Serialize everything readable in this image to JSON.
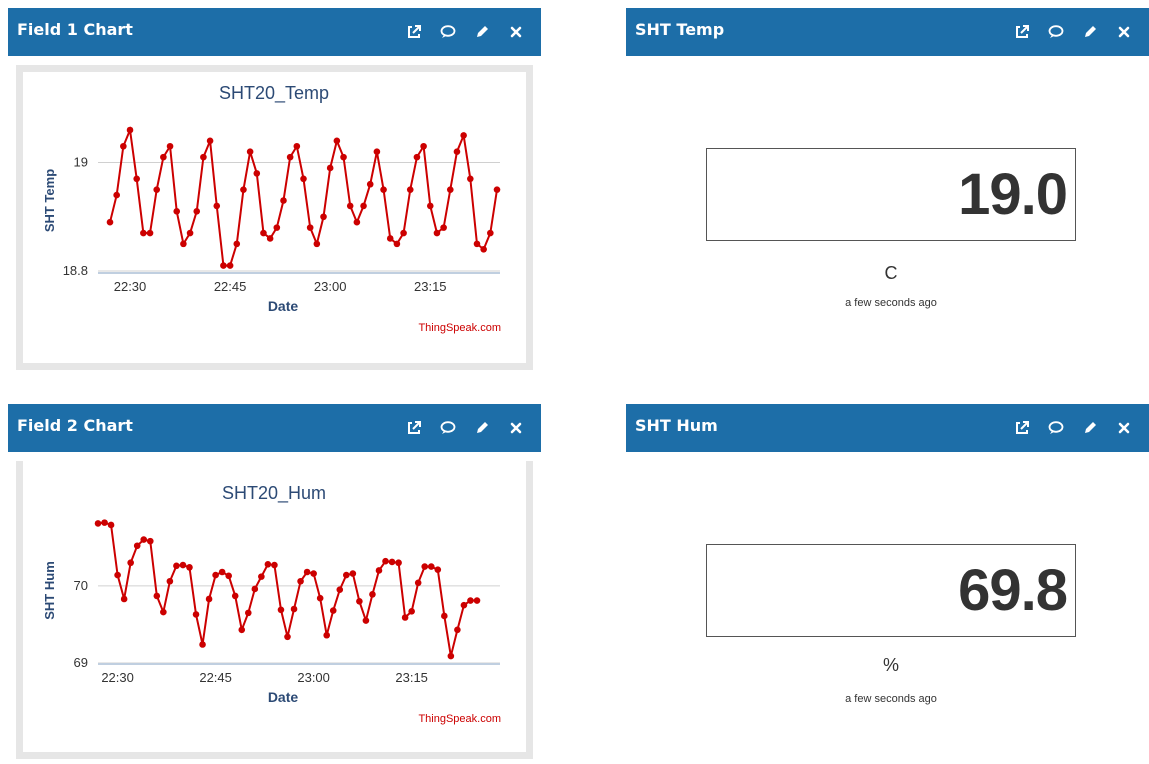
{
  "colors": {
    "header": "#1d6ea8",
    "series": "#cc0000",
    "axis_text": "#2c4a75",
    "credit": "#cc0000"
  },
  "icons": [
    "external-link-icon",
    "comment-icon",
    "pencil-icon",
    "close-icon"
  ],
  "panels": {
    "field1": {
      "title": "Field 1 Chart"
    },
    "temp": {
      "title": "SHT Temp",
      "value": "19.0",
      "unit": "C",
      "ago": "a few seconds ago"
    },
    "field2": {
      "title": "Field 2 Chart"
    },
    "hum": {
      "title": "SHT Hum",
      "value": "69.8",
      "unit": "%",
      "ago": "a few seconds ago"
    }
  },
  "chart_data": [
    {
      "type": "line",
      "title": "SHT20_Temp",
      "xlabel": "Date",
      "ylabel": "SHT Temp",
      "credit": "ThingSpeak.com",
      "x_ticks": [
        "22:30",
        "22:45",
        "23:00",
        "23:15"
      ],
      "y_ticks": [
        "18.8",
        "19"
      ],
      "grid": true,
      "series": [
        {
          "x": [
            "22:27",
            "22:28",
            "22:29",
            "22:30",
            "22:31",
            "22:32",
            "22:33",
            "22:34",
            "22:35",
            "22:36",
            "22:37",
            "22:38",
            "22:39",
            "22:40",
            "22:41",
            "22:42",
            "22:43",
            "22:44",
            "22:45",
            "22:46",
            "22:47",
            "22:48",
            "22:49",
            "22:50",
            "22:51",
            "22:52",
            "22:53",
            "22:54",
            "22:55",
            "22:56",
            "22:57",
            "22:58",
            "22:59",
            "23:00",
            "23:01",
            "23:02",
            "23:03",
            "23:04",
            "23:05",
            "23:06",
            "23:07",
            "23:08",
            "23:09",
            "23:10",
            "23:11",
            "23:12",
            "23:13",
            "23:14",
            "23:15",
            "23:16",
            "23:17",
            "23:18",
            "23:19",
            "23:20",
            "23:21",
            "23:22",
            "23:23",
            "23:24",
            "23:25"
          ],
          "values": [
            18.89,
            18.94,
            19.03,
            19.06,
            18.97,
            18.87,
            18.87,
            18.95,
            19.01,
            19.03,
            18.91,
            18.85,
            18.87,
            18.91,
            19.01,
            19.04,
            18.92,
            18.81,
            18.81,
            18.85,
            18.95,
            19.02,
            18.98,
            18.87,
            18.86,
            18.88,
            18.93,
            19.01,
            19.03,
            18.97,
            18.88,
            18.85,
            18.9,
            18.99,
            19.04,
            19.01,
            18.92,
            18.89,
            18.92,
            18.96,
            19.02,
            18.95,
            18.86,
            18.85,
            18.87,
            18.95,
            19.01,
            19.03,
            18.92,
            18.87,
            18.88,
            18.95,
            19.02,
            19.05,
            18.97,
            18.85,
            18.84,
            18.87,
            18.95
          ]
        }
      ]
    },
    {
      "type": "line",
      "title": "SHT20_Hum",
      "xlabel": "Date",
      "ylabel": "SHT Hum",
      "credit": "ThingSpeak.com",
      "x_ticks": [
        "22:30",
        "22:45",
        "23:00",
        "23:15"
      ],
      "y_ticks": [
        "69",
        "70"
      ],
      "grid": true,
      "series": [
        {
          "x": [
            "22:27",
            "22:28",
            "22:29",
            "22:30",
            "22:31",
            "22:32",
            "22:33",
            "22:34",
            "22:35",
            "22:36",
            "22:37",
            "22:38",
            "22:39",
            "22:40",
            "22:41",
            "22:42",
            "22:43",
            "22:44",
            "22:45",
            "22:46",
            "22:47",
            "22:48",
            "22:49",
            "22:50",
            "22:51",
            "22:52",
            "22:53",
            "22:54",
            "22:55",
            "22:56",
            "22:57",
            "22:58",
            "22:59",
            "23:00",
            "23:01",
            "23:02",
            "23:03",
            "23:04",
            "23:05",
            "23:06",
            "23:07",
            "23:08",
            "23:09",
            "23:10",
            "23:11",
            "23:12",
            "23:13",
            "23:14",
            "23:15",
            "23:16",
            "23:17",
            "23:18",
            "23:19",
            "23:20",
            "23:21",
            "23:22",
            "23:23",
            "23:24",
            "23:25"
          ],
          "values": [
            70.81,
            70.82,
            70.79,
            70.14,
            69.83,
            70.3,
            70.52,
            70.6,
            70.58,
            69.87,
            69.66,
            70.06,
            70.26,
            70.27,
            70.24,
            69.63,
            69.24,
            69.83,
            70.14,
            70.18,
            70.13,
            69.87,
            69.43,
            69.65,
            69.96,
            70.12,
            70.28,
            70.27,
            69.69,
            69.34,
            69.7,
            70.06,
            70.18,
            70.16,
            69.84,
            69.36,
            69.68,
            69.95,
            70.14,
            70.16,
            69.8,
            69.55,
            69.89,
            70.2,
            70.32,
            70.31,
            70.3,
            69.59,
            69.67,
            70.04,
            70.25,
            70.25,
            70.21,
            69.61,
            69.09,
            69.43,
            69.75,
            69.81,
            69.81
          ]
        }
      ]
    }
  ]
}
